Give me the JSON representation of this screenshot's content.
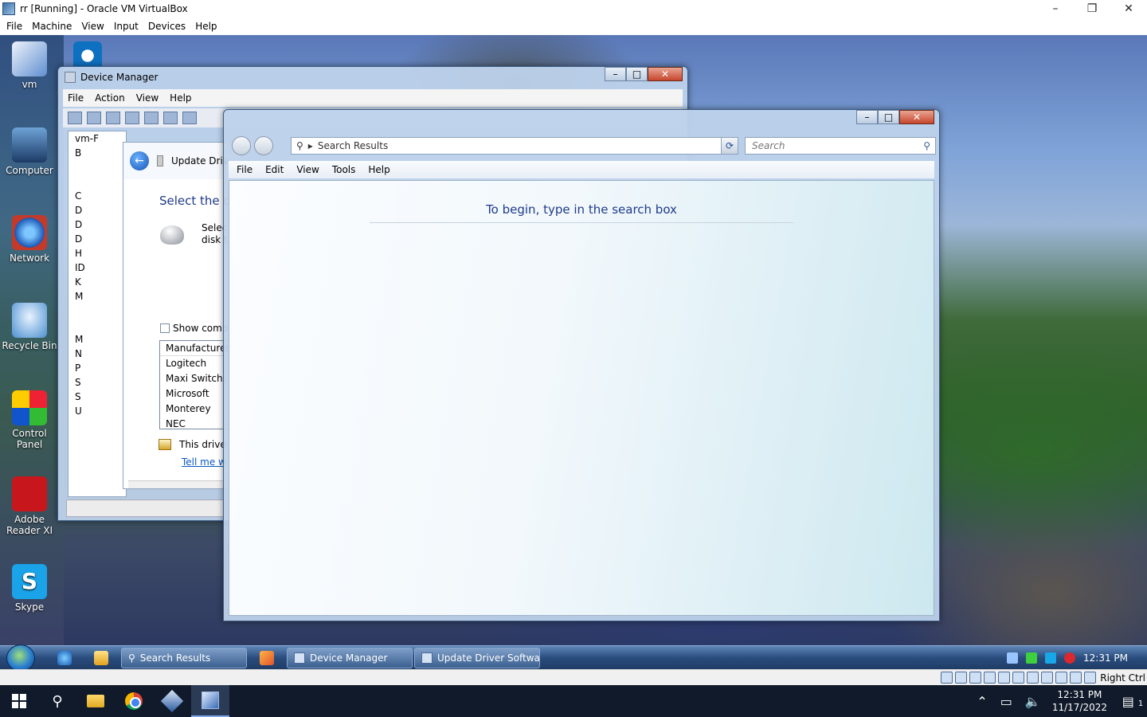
{
  "host": {
    "window_title": "rr [Running] - Oracle VM VirtualBox",
    "menu": [
      "File",
      "Machine",
      "View",
      "Input",
      "Devices",
      "Help"
    ],
    "controls": {
      "minimize": "–",
      "restore": "❐",
      "close": "✕"
    }
  },
  "desktop_icons": [
    {
      "label": "vm",
      "icon": "vm-user-icon"
    },
    {
      "label": "",
      "icon": "teamviewer-icon"
    },
    {
      "label": "Computer",
      "icon": "computer-icon"
    },
    {
      "label": "Network",
      "icon": "network-icon"
    },
    {
      "label": "Recycle Bin",
      "icon": "recycle-bin-icon"
    },
    {
      "label": "Control Panel",
      "icon": "control-panel-icon"
    },
    {
      "label": "Adobe Reader XI",
      "icon": "adobe-reader-icon"
    },
    {
      "label": "Skype",
      "icon": "skype-icon",
      "glyph": "S"
    }
  ],
  "device_manager": {
    "title": "Device Manager",
    "menu": [
      "File",
      "Action",
      "View",
      "Help"
    ],
    "tree": [
      "vm-F",
      "B",
      "",
      "",
      "C",
      "D",
      "D",
      "D",
      "H",
      "ID",
      "K",
      "M",
      "",
      "",
      "M",
      "N",
      "P",
      "S",
      "S",
      "U"
    ]
  },
  "update_driver": {
    "title": "Update Driv",
    "heading": "Select the d",
    "select_text_1": "Selec",
    "select_text_2": "disk t",
    "show_compatible": "Show comp",
    "list_header": "Manufacturer",
    "manufacturers": [
      "Logitech",
      "Maxi Switch, I",
      "Microsoft",
      "Monterey",
      "NEC"
    ],
    "signed_text": "This drive",
    "link_text": "Tell me w"
  },
  "search_window": {
    "address_text": "Search Results",
    "search_placeholder": "Search",
    "menu": [
      "File",
      "Edit",
      "View",
      "Tools",
      "Help"
    ],
    "message": "To begin, type in the search box"
  },
  "guest_taskbar": {
    "buttons": [
      {
        "label": "Search Results",
        "icon": "search-icon"
      },
      {
        "label": "Device Manager",
        "icon": "device-manager-icon"
      },
      {
        "label": "Update Driver Softwa...",
        "icon": "driver-icon"
      }
    ],
    "time": "12:31 PM"
  },
  "vbox_status": {
    "host_key": "Right Ctrl"
  },
  "host_taskbar": {
    "time": "12:31 PM",
    "date": "11/17/2022",
    "notifications_count": "1"
  }
}
